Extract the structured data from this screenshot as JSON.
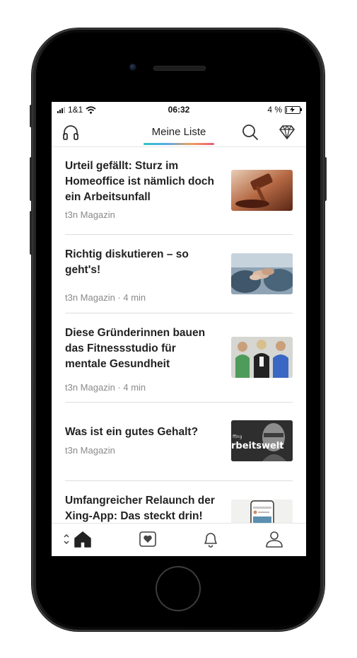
{
  "status_bar": {
    "carrier": "1&1",
    "time": "06:32",
    "battery": "4 %",
    "battery_level": 0.04
  },
  "header": {
    "title": "Meine Liste"
  },
  "articles": [
    {
      "title": "Urteil gefällt: Sturz im Homeoffice ist nämlich doch ein Arbeitsunfall",
      "meta": "t3n Magazin",
      "thumb": "judge-gavel-image"
    },
    {
      "title": "Richtig diskutieren – so geht's!",
      "meta": "t3n Magazin · 4 min",
      "thumb": "hands-discussion-image"
    },
    {
      "title": "Diese Gründerinnen bauen das Fitnessstudio für mentale Gesundheit",
      "meta": "t3n Magazin · 4 min",
      "thumb": "three-founders-image"
    },
    {
      "title": "Was ist ein gutes Gehalt?",
      "meta": "t3n Magazin",
      "thumb": "arbeitswelt-image",
      "thumb_text": "rbeitswelt",
      "thumb_small": "ffing"
    },
    {
      "title": "Umfangreicher Relaunch der Xing-App: Das steckt drin!",
      "meta": "",
      "thumb": "app-screenshot-image"
    }
  ],
  "tabbar": {
    "items": [
      "home",
      "saved",
      "notifications",
      "profile"
    ]
  },
  "colors": {
    "accent_gradient": [
      "#2ec4c4",
      "#5aa9e6",
      "#f0a05a",
      "#e85d75"
    ]
  }
}
